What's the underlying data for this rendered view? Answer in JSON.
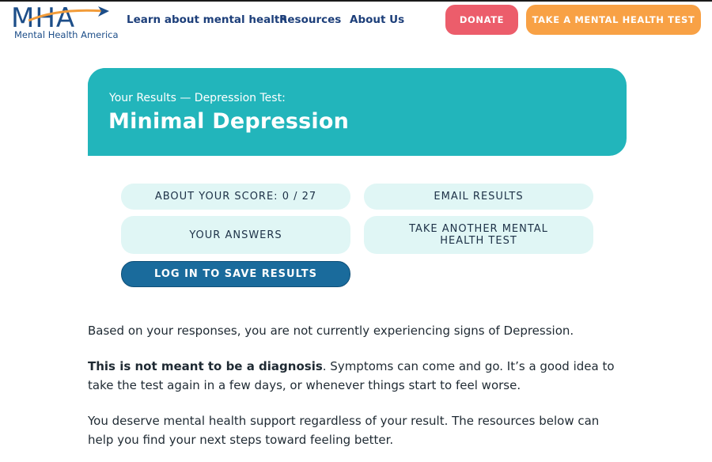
{
  "header": {
    "logo_text": "MHA",
    "logo_subtitle": "Mental Health America",
    "nav": [
      "Learn about mental health",
      "Resources",
      "About Us"
    ],
    "donate_label": "DONATE",
    "take_test_label": "TAKE A MENTAL HEALTH TEST"
  },
  "result": {
    "subtitle": "Your Results — Depression Test:",
    "title": "Minimal Depression"
  },
  "actions": {
    "score": "ABOUT YOUR SCORE: 0 / 27",
    "email": "EMAIL RESULTS",
    "answers": "YOUR ANSWERS",
    "another": "TAKE ANOTHER MENTAL HEALTH TEST",
    "login": "LOG IN TO SAVE RESULTS"
  },
  "body": {
    "p1": "Based on your responses, you are not currently experiencing signs of Depression.",
    "p2_bold": "This is not meant to be a diagnosis",
    "p2_rest": ". Symptoms can come and go. It’s a good idea to take the test again in a few days, or whenever things start to feel worse.",
    "p3": "You deserve mental health support regardless of your result. The resources below can help you find your next steps toward feeling better."
  },
  "colors": {
    "brand_navy": "#1d3f7a",
    "banner_teal": "#22b5bb",
    "donate_red": "#ec5d6b",
    "test_orange": "#f8a145",
    "pill_light": "#e0f6f5",
    "login_blue": "#1a6b9c"
  }
}
